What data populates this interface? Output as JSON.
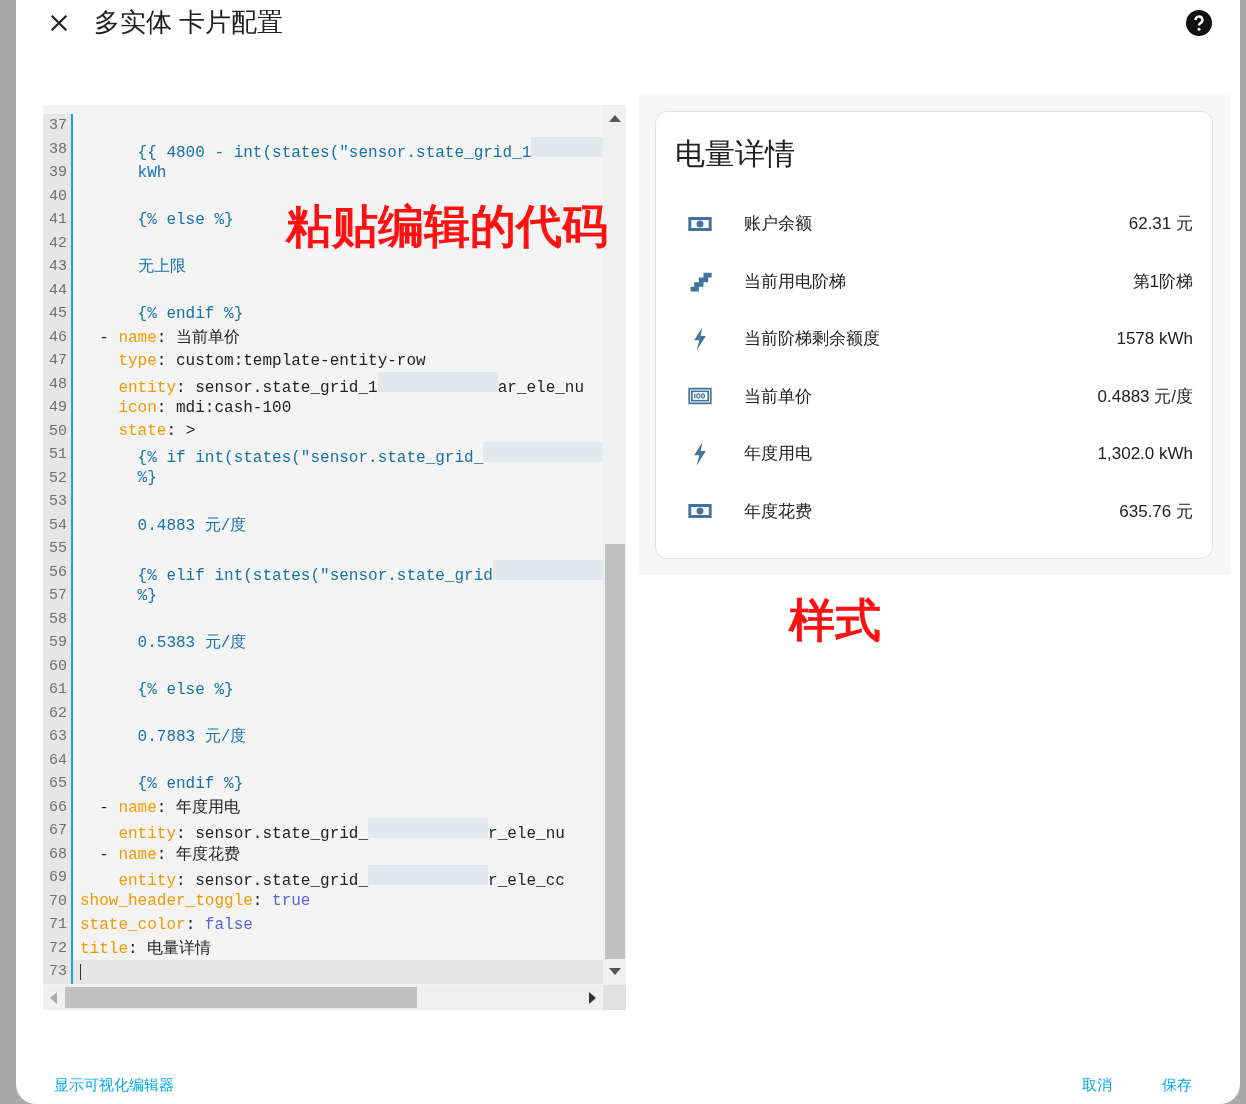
{
  "dialog": {
    "title": "多实体 卡片配置"
  },
  "editor": {
    "lines": [
      {
        "number": "37",
        "active": false
      },
      {
        "number": "38",
        "active": false,
        "segments": [
          {
            "kind": "tpl",
            "text": "      {{ 4800 - int(states(\"sensor.state_grid_1"
          },
          {
            "kind": "blur"
          }
        ]
      },
      {
        "number": "39",
        "active": false,
        "segments": [
          {
            "kind": "tpl",
            "text": "      kWh"
          }
        ]
      },
      {
        "number": "40",
        "active": false
      },
      {
        "number": "41",
        "active": false,
        "segments": [
          {
            "kind": "tpl",
            "text": "      {% else %}"
          }
        ]
      },
      {
        "number": "42",
        "active": false
      },
      {
        "number": "43",
        "active": false,
        "segments": [
          {
            "kind": "tpl",
            "text": "      无上限"
          }
        ]
      },
      {
        "number": "44",
        "active": false
      },
      {
        "number": "45",
        "active": false,
        "segments": [
          {
            "kind": "tpl",
            "text": "      {% endif %}"
          }
        ]
      },
      {
        "number": "46",
        "active": false,
        "segments": [
          {
            "kind": "plain",
            "text": "  - "
          },
          {
            "kind": "key",
            "text": "name"
          },
          {
            "kind": "plain",
            "text": ": 当前单价"
          }
        ]
      },
      {
        "number": "47",
        "active": false,
        "segments": [
          {
            "kind": "key",
            "text": "    type"
          },
          {
            "kind": "plain",
            "text": ": custom:template-entity-row"
          }
        ]
      },
      {
        "number": "48",
        "active": false,
        "segments": [
          {
            "kind": "key",
            "text": "    entity"
          },
          {
            "kind": "plain",
            "text": ": sensor.state_grid_1"
          },
          {
            "kind": "blur"
          },
          {
            "kind": "plain",
            "text": "ar_ele_nu"
          }
        ]
      },
      {
        "number": "49",
        "active": false,
        "segments": [
          {
            "kind": "key",
            "text": "    icon"
          },
          {
            "kind": "plain",
            "text": ": mdi:cash-100"
          }
        ]
      },
      {
        "number": "50",
        "active": false,
        "segments": [
          {
            "kind": "key",
            "text": "    state"
          },
          {
            "kind": "plain",
            "text": ": >"
          }
        ]
      },
      {
        "number": "51",
        "active": false,
        "segments": [
          {
            "kind": "tpl",
            "text": "      {% if int(states(\"sensor.state_grid_"
          },
          {
            "kind": "blur"
          }
        ]
      },
      {
        "number": "52",
        "active": false,
        "segments": [
          {
            "kind": "tpl",
            "text": "      %}"
          }
        ]
      },
      {
        "number": "53",
        "active": false
      },
      {
        "number": "54",
        "active": false,
        "segments": [
          {
            "kind": "tpl",
            "text": "      0.4883 元/度"
          }
        ]
      },
      {
        "number": "55",
        "active": false
      },
      {
        "number": "56",
        "active": false,
        "segments": [
          {
            "kind": "tpl",
            "text": "      {% elif int(states(\"sensor.state_grid"
          },
          {
            "kind": "blur"
          }
        ]
      },
      {
        "number": "57",
        "active": false,
        "segments": [
          {
            "kind": "tpl",
            "text": "      %}"
          }
        ]
      },
      {
        "number": "58",
        "active": false
      },
      {
        "number": "59",
        "active": false,
        "segments": [
          {
            "kind": "tpl",
            "text": "      0.5383 元/度"
          }
        ]
      },
      {
        "number": "60",
        "active": false
      },
      {
        "number": "61",
        "active": false,
        "segments": [
          {
            "kind": "tpl",
            "text": "      {% else %}"
          }
        ]
      },
      {
        "number": "62",
        "active": false
      },
      {
        "number": "63",
        "active": false,
        "segments": [
          {
            "kind": "tpl",
            "text": "      0.7883 元/度"
          }
        ]
      },
      {
        "number": "64",
        "active": false
      },
      {
        "number": "65",
        "active": false,
        "segments": [
          {
            "kind": "tpl",
            "text": "      {% endif %}"
          }
        ]
      },
      {
        "number": "66",
        "active": false,
        "segments": [
          {
            "kind": "plain",
            "text": "  - "
          },
          {
            "kind": "key",
            "text": "name"
          },
          {
            "kind": "plain",
            "text": ": 年度用电"
          }
        ]
      },
      {
        "number": "67",
        "active": false,
        "segments": [
          {
            "kind": "key",
            "text": "    entity"
          },
          {
            "kind": "plain",
            "text": ": sensor.state_grid_"
          },
          {
            "kind": "blur"
          },
          {
            "kind": "plain",
            "text": "r_ele_nu"
          }
        ]
      },
      {
        "number": "68",
        "active": false,
        "segments": [
          {
            "kind": "plain",
            "text": "  - "
          },
          {
            "kind": "key",
            "text": "name"
          },
          {
            "kind": "plain",
            "text": ": 年度花费"
          }
        ]
      },
      {
        "number": "69",
        "active": false,
        "segments": [
          {
            "kind": "key",
            "text": "    entity"
          },
          {
            "kind": "plain",
            "text": ": sensor.state_grid_"
          },
          {
            "kind": "blur"
          },
          {
            "kind": "plain",
            "text": "r_ele_cc"
          }
        ]
      },
      {
        "number": "70",
        "active": false,
        "segments": [
          {
            "kind": "key",
            "text": "show_header_toggle"
          },
          {
            "kind": "plain",
            "text": ": "
          },
          {
            "kind": "bool",
            "text": "true"
          }
        ]
      },
      {
        "number": "71",
        "active": false,
        "segments": [
          {
            "kind": "key",
            "text": "state_color"
          },
          {
            "kind": "plain",
            "text": ": "
          },
          {
            "kind": "bool",
            "text": "false"
          }
        ]
      },
      {
        "number": "72",
        "active": false,
        "segments": [
          {
            "kind": "key",
            "text": "title"
          },
          {
            "kind": "plain",
            "text": ": 电量详情"
          }
        ]
      },
      {
        "number": "73",
        "active": true
      }
    ]
  },
  "annotations": [
    {
      "text": "粘贴编辑的代码"
    },
    {
      "text": "样式"
    }
  ],
  "card": {
    "title": "电量详情",
    "rows": [
      {
        "kind": "cash",
        "name": "账户余额",
        "value": "62.31 元"
      },
      {
        "kind": "stairs",
        "name": "当前用电阶梯",
        "value": "第1阶梯"
      },
      {
        "kind": "flash",
        "name": "当前阶梯剩余额度",
        "value": "1578 kWh"
      },
      {
        "kind": "cash-100",
        "name": "当前单价",
        "value": "0.4883 元/度"
      },
      {
        "kind": "flash",
        "name": "年度用电",
        "value": "1,302.0 kWh"
      },
      {
        "kind": "cash",
        "name": "年度花费",
        "value": "635.76 元"
      }
    ]
  },
  "footer": {
    "link": "显示可视化编辑器",
    "buttons": [
      "取消",
      "保存"
    ]
  }
}
